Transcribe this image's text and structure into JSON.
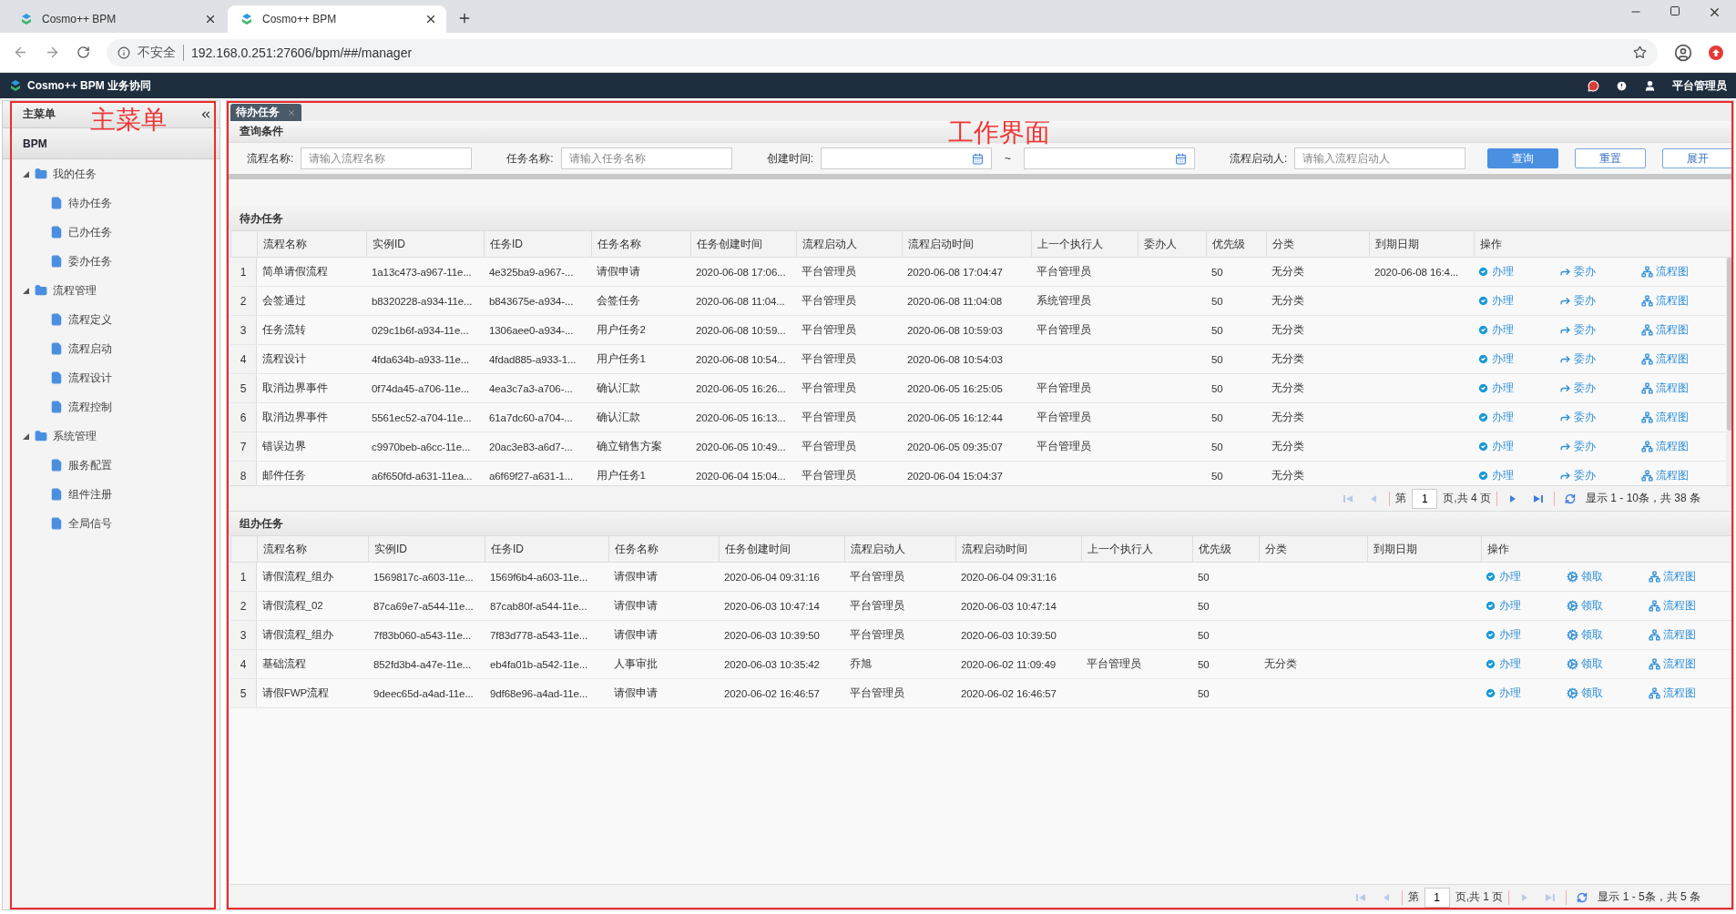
{
  "browser": {
    "tabs": [
      {
        "title": "Cosmo++ BPM",
        "selected": false
      },
      {
        "title": "Cosmo++ BPM",
        "selected": true
      }
    ],
    "security": "不安全",
    "url": "192.168.0.251:27606/bpm/##/manager"
  },
  "app_header": {
    "title": "Cosmo++ BPM 业务协同",
    "user": "平台管理员"
  },
  "sidebar": {
    "annotation": "主菜单",
    "title": "主菜单",
    "section": "BPM",
    "tree": [
      {
        "label": "我的任务",
        "expanded": true,
        "children": [
          {
            "label": "待办任务"
          },
          {
            "label": "已办任务"
          },
          {
            "label": "委办任务"
          }
        ]
      },
      {
        "label": "流程管理",
        "expanded": true,
        "children": [
          {
            "label": "流程定义"
          },
          {
            "label": "流程启动"
          },
          {
            "label": "流程设计"
          },
          {
            "label": "流程控制"
          }
        ]
      },
      {
        "label": "系统管理",
        "expanded": true,
        "children": [
          {
            "label": "服务配置"
          },
          {
            "label": "组件注册"
          },
          {
            "label": "全局信号"
          }
        ]
      }
    ]
  },
  "main": {
    "annotation": "工作界面",
    "tabs": [
      {
        "label": "待办任务",
        "selected": true
      }
    ],
    "query": {
      "title": "查询条件",
      "fields": [
        {
          "kind": "text",
          "label": "流程名称:",
          "placeholder": "请输入流程名称"
        },
        {
          "kind": "text",
          "label": "任务名称:",
          "placeholder": "请输入任务名称"
        },
        {
          "kind": "daterange",
          "label": "创建时间:",
          "separator": "~"
        },
        {
          "kind": "text",
          "label": "流程启动人:",
          "placeholder": "请输入流程启动人"
        }
      ],
      "buttons": [
        {
          "label": "查询",
          "primary": true
        },
        {
          "label": "重置",
          "primary": false
        },
        {
          "label": "展开",
          "primary": false
        }
      ]
    },
    "grids": [
      {
        "title": "待办任务",
        "columns": [
          "流程名称",
          "实例ID",
          "任务ID",
          "任务名称",
          "任务创建时间",
          "流程启动人",
          "流程启动时间",
          "上一个执行人",
          "委办人",
          "优先级",
          "分类",
          "到期日期",
          "操作"
        ],
        "rows": [
          {
            "index": "1",
            "cells": [
              "简单请假流程",
              "1a13c473-a967-11e...",
              "4e325ba9-a967-...",
              "请假申请",
              "2020-06-08 17:06...",
              "平台管理员",
              "2020-06-08 17:04:47",
              "平台管理员",
              null,
              "50",
              "无分类",
              "2020-06-08 16:4..."
            ],
            "actions": [
              {
                "kind": "handle",
                "label": "办理"
              },
              {
                "kind": "delegate",
                "label": "委办"
              },
              {
                "kind": "diagram",
                "label": "流程图"
              }
            ]
          },
          {
            "index": "2",
            "cells": [
              "会签通过",
              "b8320228-a934-11e...",
              "b843675e-a934-...",
              "会签任务",
              "2020-06-08 11:04...",
              "平台管理员",
              "2020-06-08 11:04:08",
              "系统管理员",
              null,
              "50",
              "无分类",
              null
            ],
            "actions": [
              {
                "kind": "handle",
                "label": "办理"
              },
              {
                "kind": "delegate",
                "label": "委办"
              },
              {
                "kind": "diagram",
                "label": "流程图"
              }
            ]
          },
          {
            "index": "3",
            "cells": [
              "任务流转",
              "029c1b6f-a934-11e...",
              "1306aee0-a934-...",
              "用户任务2",
              "2020-06-08 10:59...",
              "平台管理员",
              "2020-06-08 10:59:03",
              "平台管理员",
              null,
              "50",
              "无分类",
              null
            ],
            "actions": [
              {
                "kind": "handle",
                "label": "办理"
              },
              {
                "kind": "delegate",
                "label": "委办"
              },
              {
                "kind": "diagram",
                "label": "流程图"
              }
            ]
          },
          {
            "index": "4",
            "cells": [
              "流程设计",
              "4fda634b-a933-11e...",
              "4fdad885-a933-1...",
              "用户任务1",
              "2020-06-08 10:54...",
              "平台管理员",
              "2020-06-08 10:54:03",
              null,
              null,
              "50",
              "无分类",
              null
            ],
            "actions": [
              {
                "kind": "handle",
                "label": "办理"
              },
              {
                "kind": "delegate",
                "label": "委办"
              },
              {
                "kind": "diagram",
                "label": "流程图"
              }
            ]
          },
          {
            "index": "5",
            "cells": [
              "取消边界事件",
              "0f74da45-a706-11e...",
              "4ea3c7a3-a706-...",
              "确认汇款",
              "2020-06-05 16:26...",
              "平台管理员",
              "2020-06-05 16:25:05",
              "平台管理员",
              null,
              "50",
              "无分类",
              null
            ],
            "actions": [
              {
                "kind": "handle",
                "label": "办理"
              },
              {
                "kind": "delegate",
                "label": "委办"
              },
              {
                "kind": "diagram",
                "label": "流程图"
              }
            ]
          },
          {
            "index": "6",
            "cells": [
              "取消边界事件",
              "5561ec52-a704-11e...",
              "61a7dc60-a704-...",
              "确认汇款",
              "2020-06-05 16:13...",
              "平台管理员",
              "2020-06-05 16:12:44",
              "平台管理员",
              null,
              "50",
              "无分类",
              null
            ],
            "actions": [
              {
                "kind": "handle",
                "label": "办理"
              },
              {
                "kind": "delegate",
                "label": "委办"
              },
              {
                "kind": "diagram",
                "label": "流程图"
              }
            ]
          },
          {
            "index": "7",
            "cells": [
              "错误边界",
              "c9970beb-a6cc-11e...",
              "20ac3e83-a6d7-...",
              "确立销售方案",
              "2020-06-05 10:49...",
              "平台管理员",
              "2020-06-05 09:35:07",
              "平台管理员",
              null,
              "50",
              "无分类",
              null
            ],
            "actions": [
              {
                "kind": "handle",
                "label": "办理"
              },
              {
                "kind": "delegate",
                "label": "委办"
              },
              {
                "kind": "diagram",
                "label": "流程图"
              }
            ]
          },
          {
            "index": "8",
            "cells": [
              "邮件任务",
              "a6f650fd-a631-11ea...",
              "a6f69f27-a631-1...",
              "用户任务1",
              "2020-06-04 15:04...",
              "平台管理员",
              "2020-06-04 15:04:37",
              null,
              null,
              "50",
              "无分类",
              null
            ],
            "actions": [
              {
                "kind": "handle",
                "label": "办理"
              },
              {
                "kind": "delegate",
                "label": "委办"
              },
              {
                "kind": "diagram",
                "label": "流程图"
              }
            ]
          }
        ],
        "pager": {
          "buttons": [
            {
              "kind": "first",
              "disabled": true
            },
            {
              "kind": "prev",
              "disabled": true
            },
            {
              "kind": "page"
            },
            {
              "kind": "next",
              "disabled": false
            },
            {
              "kind": "last",
              "disabled": false
            },
            {
              "kind": "refresh",
              "disabled": false
            }
          ],
          "page_label": "第",
          "page": "1",
          "page_total": "页,共 4 页",
          "summary": "显示 1 - 10条，共 38 条"
        }
      },
      {
        "title": "组办任务",
        "columns": [
          "流程名称",
          "实例ID",
          "任务ID",
          "任务名称",
          "任务创建时间",
          "流程启动人",
          "流程启动时间",
          "上一个执行人",
          "优先级",
          "分类",
          "到期日期",
          "操作"
        ],
        "rows": [
          {
            "index": "1",
            "cells": [
              "请假流程_组办",
              "1569817c-a603-11e...",
              "1569f6b4-a603-11e...",
              "请假申请",
              "2020-06-04 09:31:16",
              "平台管理员",
              "2020-06-04 09:31:16",
              null,
              "50",
              null,
              null
            ],
            "actions": [
              {
                "kind": "handle",
                "label": "办理"
              },
              {
                "kind": "claim",
                "label": "领取"
              },
              {
                "kind": "diagram",
                "label": "流程图"
              }
            ]
          },
          {
            "index": "2",
            "cells": [
              "请假流程_02",
              "87ca69e7-a544-11e...",
              "87cab80f-a544-11e...",
              "请假申请",
              "2020-06-03 10:47:14",
              "平台管理员",
              "2020-06-03 10:47:14",
              null,
              "50",
              null,
              null
            ],
            "actions": [
              {
                "kind": "handle",
                "label": "办理"
              },
              {
                "kind": "claim",
                "label": "领取"
              },
              {
                "kind": "diagram",
                "label": "流程图"
              }
            ]
          },
          {
            "index": "3",
            "cells": [
              "请假流程_组办",
              "7f83b060-a543-11e...",
              "7f83d778-a543-11e...",
              "请假申请",
              "2020-06-03 10:39:50",
              "平台管理员",
              "2020-06-03 10:39:50",
              null,
              "50",
              null,
              null
            ],
            "actions": [
              {
                "kind": "handle",
                "label": "办理"
              },
              {
                "kind": "claim",
                "label": "领取"
              },
              {
                "kind": "diagram",
                "label": "流程图"
              }
            ]
          },
          {
            "index": "4",
            "cells": [
              "基础流程",
              "852fd3b4-a47e-11e...",
              "eb4fa01b-a542-11e...",
              "人事审批",
              "2020-06-03 10:35:42",
              "乔旭",
              "2020-06-02 11:09:49",
              "平台管理员",
              "50",
              "无分类",
              null
            ],
            "actions": [
              {
                "kind": "handle",
                "label": "办理"
              },
              {
                "kind": "claim",
                "label": "领取"
              },
              {
                "kind": "diagram",
                "label": "流程图"
              }
            ]
          },
          {
            "index": "5",
            "cells": [
              "请假FWP流程",
              "9deec65d-a4ad-11e...",
              "9df68e96-a4ad-11e...",
              "请假申请",
              "2020-06-02 16:46:57",
              "平台管理员",
              "2020-06-02 16:46:57",
              null,
              "50",
              null,
              null
            ],
            "actions": [
              {
                "kind": "handle",
                "label": "办理"
              },
              {
                "kind": "claim",
                "label": "领取"
              },
              {
                "kind": "diagram",
                "label": "流程图"
              }
            ]
          }
        ],
        "pager": {
          "buttons": [
            {
              "kind": "first",
              "disabled": true
            },
            {
              "kind": "prev",
              "disabled": true
            },
            {
              "kind": "page"
            },
            {
              "kind": "next",
              "disabled": true
            },
            {
              "kind": "last",
              "disabled": true
            },
            {
              "kind": "refresh",
              "disabled": false
            }
          ],
          "page_label": "第",
          "page": "1",
          "page_total": "页,共 1 页",
          "summary": "显示 1 - 5条，共 5 条"
        }
      }
    ]
  }
}
